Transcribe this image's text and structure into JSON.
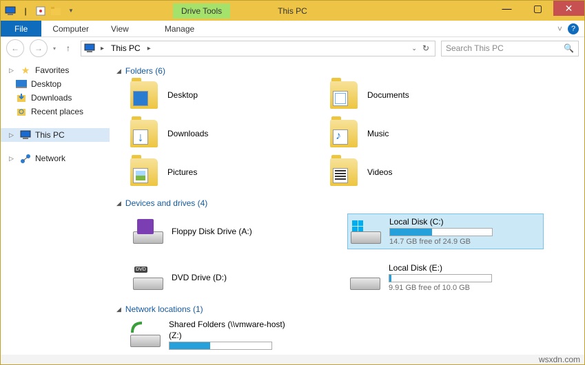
{
  "window": {
    "title": "This PC",
    "drive_tools_label": "Drive Tools"
  },
  "ribbon": {
    "file": "File",
    "tabs": [
      "Computer",
      "View",
      "Manage"
    ]
  },
  "address": {
    "location": "This PC",
    "search_placeholder": "Search This PC"
  },
  "nav": {
    "favorites": {
      "label": "Favorites",
      "items": [
        "Desktop",
        "Downloads",
        "Recent places"
      ]
    },
    "this_pc": "This PC",
    "network": "Network"
  },
  "sections": {
    "folders": {
      "header": "Folders (6)",
      "items": [
        "Desktop",
        "Documents",
        "Downloads",
        "Music",
        "Pictures",
        "Videos"
      ]
    },
    "devices": {
      "header": "Devices and drives (4)",
      "floppy": {
        "label": "Floppy Disk Drive (A:)"
      },
      "dvd": {
        "label": "DVD Drive (D:)"
      },
      "c": {
        "label": "Local Disk (C:)",
        "free": "14.7 GB free of 24.9 GB",
        "fill_pct": 41
      },
      "e": {
        "label": "Local Disk (E:)",
        "free": "9.91 GB free of 10.0 GB",
        "fill_pct": 2
      }
    },
    "network": {
      "header": "Network locations (1)",
      "shared": {
        "label": "Shared Folders (\\\\vmware-host)",
        "letter": "(Z:)",
        "fill_pct": 40
      }
    }
  },
  "footer": {
    "site": "wsxdn.com"
  }
}
